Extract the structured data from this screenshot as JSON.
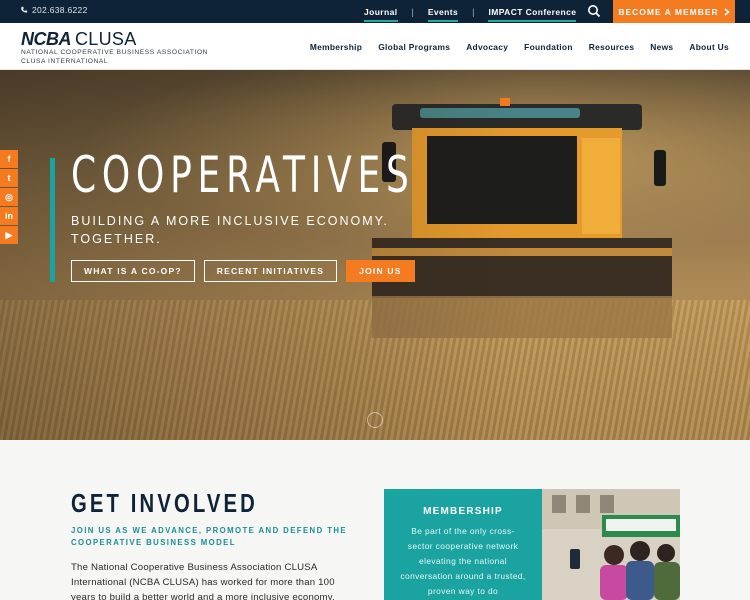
{
  "topbar": {
    "phone": "202.638.6222",
    "links": [
      {
        "label": "Journal"
      },
      {
        "label": "Events"
      },
      {
        "label": "IMPACT Conference"
      }
    ],
    "cta_label": "BECOME A MEMBER",
    "cta_icon": "chevron-right-icon",
    "search_icon": "search-icon"
  },
  "header": {
    "logo_main": "NCBA",
    "logo_suffix": "CLUSA",
    "logo_sub_line1": "NATIONAL COOPERATIVE BUSINESS ASSOCIATION",
    "logo_sub_line2": "CLUSA INTERNATIONAL",
    "nav": [
      {
        "label": "Membership"
      },
      {
        "label": "Global Programs"
      },
      {
        "label": "Advocacy"
      },
      {
        "label": "Foundation"
      },
      {
        "label": "Resources"
      },
      {
        "label": "News"
      },
      {
        "label": "About Us"
      }
    ]
  },
  "hero": {
    "title": "COOPERATIVES",
    "subtitle": "BUILDING A MORE INCLUSIVE ECONOMY. TOGETHER.",
    "buttons": [
      {
        "label": "WHAT IS A CO-OP?"
      },
      {
        "label": "RECENT INITIATIVES"
      },
      {
        "label": "JOIN US"
      }
    ],
    "social": [
      {
        "icon": "facebook-icon",
        "glyph": "f"
      },
      {
        "icon": "twitter-icon",
        "glyph": "t"
      },
      {
        "icon": "instagram-icon",
        "glyph": "◎"
      },
      {
        "icon": "linkedin-icon",
        "glyph": "in"
      },
      {
        "icon": "youtube-icon",
        "glyph": "▶"
      }
    ]
  },
  "involved": {
    "title": "GET INVOLVED",
    "tagline": "JOIN US AS WE ADVANCE, PROMOTE AND DEFEND THE COOPERATIVE BUSINESS MODEL",
    "body": "The National Cooperative Business Association CLUSA International (NCBA CLUSA) has worked for more than 100 years to build a better world and a more inclusive economy.",
    "card_title": "MEMBERSHIP",
    "card_text": "Be part of the only cross-sector cooperative network elevating the national conversation around a trusted, proven way to do"
  },
  "colors": {
    "navy": "#0e2238",
    "orange": "#f47b20",
    "teal": "#1aa3a0"
  }
}
